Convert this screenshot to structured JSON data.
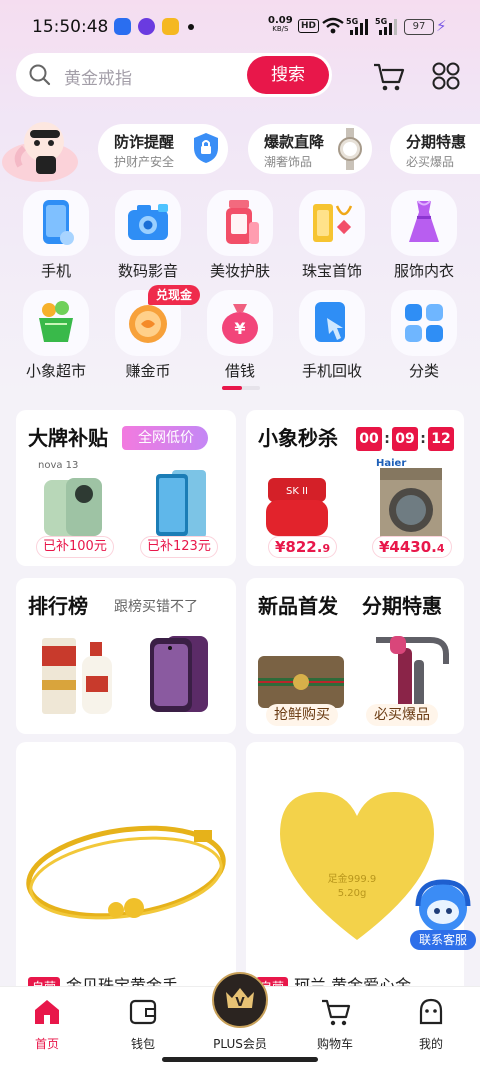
{
  "status_bar": {
    "time": "15:50:48",
    "net_speed": "0.09",
    "net_unit": "KB/S",
    "hd": "HD",
    "sig1": "5G",
    "sig2": "5G",
    "battery": "97"
  },
  "search": {
    "placeholder": "黄金戒指",
    "button": "搜索"
  },
  "promos": [
    {
      "title": "防诈提醒",
      "sub": "护财产安全"
    },
    {
      "title": "爆款直降",
      "sub": "潮奢饰品"
    },
    {
      "title": "分期特惠",
      "sub": "必买爆品"
    }
  ],
  "categories": [
    {
      "label": "手机"
    },
    {
      "label": "数码影音"
    },
    {
      "label": "美妆护肤"
    },
    {
      "label": "珠宝首饰"
    },
    {
      "label": "服饰内衣"
    },
    {
      "label": "小象超市"
    },
    {
      "label": "赚金币"
    },
    {
      "label": "借钱"
    },
    {
      "label": "手机回收"
    },
    {
      "label": "分类"
    }
  ],
  "cash_badge": "兑现金",
  "cards": {
    "brand": {
      "title": "大牌补贴",
      "tag": "全网低价",
      "price1": "已补100元",
      "price2": "已补123元",
      "phone_name": "nova 13"
    },
    "flash": {
      "title": "小象秒杀",
      "h": "00",
      "m": "09",
      "s": "12",
      "price1_int": "¥822.",
      "price1_dec": "9",
      "price2_int": "¥4430.",
      "price2_dec": "4",
      "brand_logo": "Haier",
      "sk": "SK II"
    },
    "rank": {
      "title": "排行榜",
      "sub": "跟榜买错不了"
    },
    "newp": {
      "title": "新品首发",
      "label": "抢鲜购买"
    },
    "install": {
      "title": "分期特惠",
      "label": "必买爆品"
    }
  },
  "products": [
    {
      "tag": "自营",
      "name": "金贝珠宝黄金手"
    },
    {
      "tag": "自营",
      "name": "珂兰 黄金爱心金"
    }
  ],
  "gold_engrave": {
    "line1": "足金999.9",
    "line2": "5.20g"
  },
  "customer_service": "联系客服",
  "nav": [
    {
      "label": "首页"
    },
    {
      "label": "钱包"
    },
    {
      "label": "PLUS会员"
    },
    {
      "label": "购物车"
    },
    {
      "label": "我的"
    }
  ],
  "colors": {
    "accent": "#e8174a",
    "bg": "#f4f2f8"
  }
}
